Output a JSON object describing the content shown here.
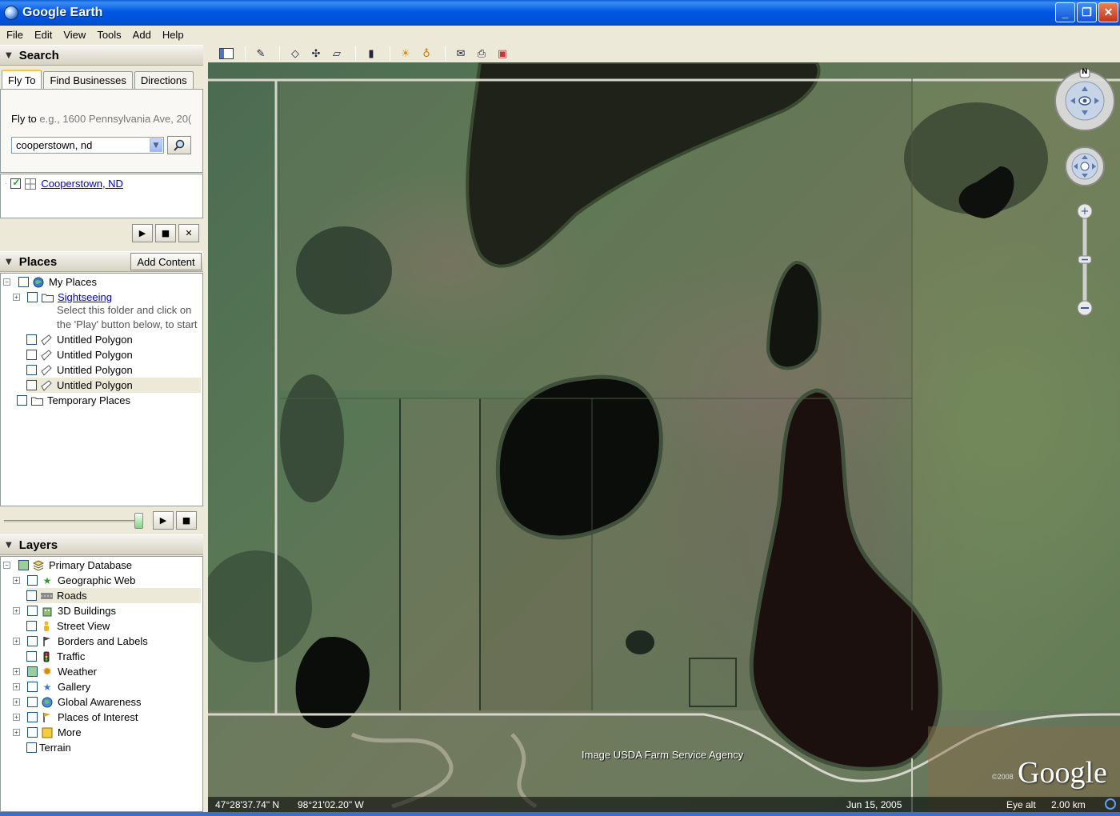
{
  "window": {
    "title": "Google Earth",
    "minimize": "_",
    "maximize": "❐",
    "close": "✕"
  },
  "menu": [
    "File",
    "Edit",
    "View",
    "Tools",
    "Add",
    "Help"
  ],
  "search": {
    "header": "Search",
    "tabs": [
      "Fly To",
      "Find Businesses",
      "Directions"
    ],
    "fly_label": "Fly to",
    "fly_hint": "e.g., 1600 Pennsylvania Ave, 20(",
    "query": "cooperstown, nd",
    "result": "Cooperstown, ND"
  },
  "places": {
    "header": "Places",
    "add_content": "Add Content",
    "items": [
      {
        "label": "My Places"
      },
      {
        "label": "Sightseeing"
      },
      {
        "label": "Untitled Polygon"
      },
      {
        "label": "Untitled Polygon"
      },
      {
        "label": "Untitled Polygon"
      },
      {
        "label": "Untitled Polygon"
      },
      {
        "label": "Temporary Places"
      }
    ],
    "sightseeing_desc_1": "Select this folder and click on",
    "sightseeing_desc_2": "the 'Play' button below, to start"
  },
  "layers": {
    "header": "Layers",
    "items": [
      {
        "label": "Primary Database"
      },
      {
        "label": "Geographic Web"
      },
      {
        "label": "Roads"
      },
      {
        "label": "3D Buildings"
      },
      {
        "label": "Street View"
      },
      {
        "label": "Borders and Labels"
      },
      {
        "label": "Traffic"
      },
      {
        "label": "Weather"
      },
      {
        "label": "Gallery"
      },
      {
        "label": "Global Awareness"
      },
      {
        "label": "Places of Interest"
      },
      {
        "label": "More"
      },
      {
        "label": "Terrain"
      }
    ]
  },
  "map": {
    "attribution": "Image USDA Farm Service Agency",
    "logo": "Google",
    "copyright": "©2008",
    "lat": "47°28'37.74\" N",
    "lon": "98°21'02.20\" W",
    "date": "Jun 15, 2005",
    "eye_label": "Eye alt",
    "eye_value": "2.00 km",
    "north": "N"
  },
  "colors": {
    "titlebar": "#0058e4",
    "link": "#0000cc",
    "panel": "#ece9d8"
  }
}
